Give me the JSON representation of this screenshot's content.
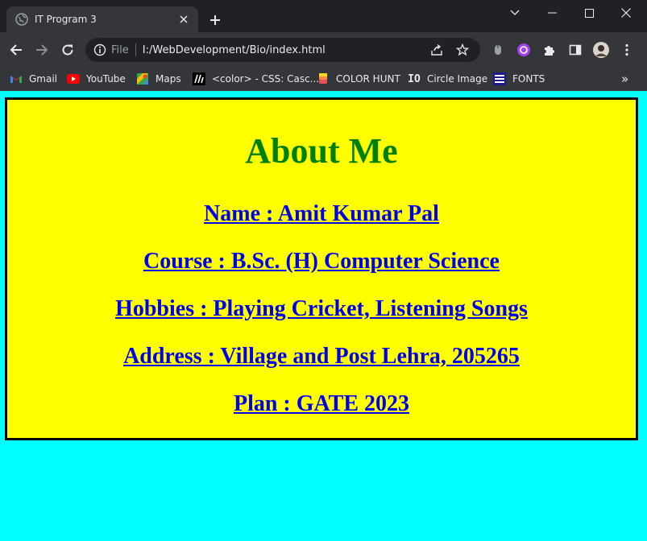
{
  "browser": {
    "tab_title": "IT Program 3",
    "omnibox": {
      "scheme_label": "File",
      "url": "I:/WebDevelopment/Bio/index.html"
    },
    "bookmarks": [
      {
        "label": "Gmail",
        "icon": "gmail-icon"
      },
      {
        "label": "YouTube",
        "icon": "youtube-icon"
      },
      {
        "label": "Maps",
        "icon": "maps-icon"
      },
      {
        "label": "<color> - CSS: Casc...",
        "icon": "mdn-icon"
      },
      {
        "label": "COLOR HUNT",
        "icon": "colorhunt-icon"
      },
      {
        "label": "Circle Image",
        "icon": "io-icon"
      },
      {
        "label": "FONTS",
        "icon": "dafont-icon"
      }
    ],
    "overflow_label": "»"
  },
  "page": {
    "heading": "About Me",
    "lines": [
      "Name : Amit Kumar Pal",
      "Course : B.Sc. (H) Computer Science",
      "Hobbies : Playing Cricket, Listening Songs",
      "Address : Village and Post Lehra, 205265",
      "Plan : GATE 2023"
    ]
  },
  "colors": {
    "page_background": "#00ffff",
    "box_background": "#ffff00",
    "heading_color": "#008000",
    "link_color": "#0000ee"
  }
}
